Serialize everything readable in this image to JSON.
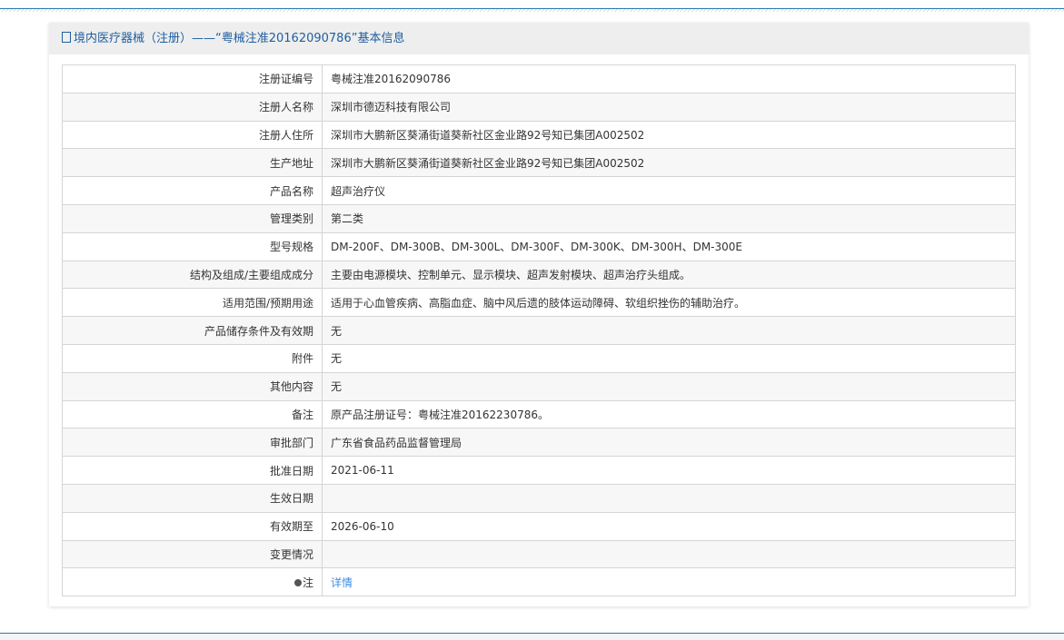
{
  "title": "境内医疗器械（注册）——“粤械注准20162090786”基本信息",
  "rows": [
    {
      "label": "注册证编号",
      "value": "粤械注准20162090786"
    },
    {
      "label": "注册人名称",
      "value": "深圳市德迈科技有限公司"
    },
    {
      "label": "注册人住所",
      "value": "深圳市大鹏新区葵涌街道葵新社区金业路92号知已集团A002502"
    },
    {
      "label": "生产地址",
      "value": "深圳市大鹏新区葵涌街道葵新社区金业路92号知已集团A002502"
    },
    {
      "label": "产品名称",
      "value": "超声治疗仪"
    },
    {
      "label": "管理类别",
      "value": "第二类"
    },
    {
      "label": "型号规格",
      "value": "DM-200F、DM-300B、DM-300L、DM-300F、DM-300K、DM-300H、DM-300E"
    },
    {
      "label": "结构及组成/主要组成成分",
      "value": "主要由电源模块、控制单元、显示模块、超声发射模块、超声治疗头组成。"
    },
    {
      "label": "适用范围/预期用途",
      "value": "适用于心血管疾病、高脂血症、脑中风后遗的肢体运动障碍、软组织挫伤的辅助治疗。"
    },
    {
      "label": "产品储存条件及有效期",
      "value": "无"
    },
    {
      "label": "附件",
      "value": "无"
    },
    {
      "label": "其他内容",
      "value": "无"
    },
    {
      "label": "备注",
      "value": "原产品注册证号：粤械注准20162230786。"
    },
    {
      "label": "审批部门",
      "value": "广东省食品药品监督管理局"
    },
    {
      "label": "批准日期",
      "value": "2021-06-11"
    },
    {
      "label": "生效日期",
      "value": ""
    },
    {
      "label": "有效期至",
      "value": "2026-06-10"
    },
    {
      "label": "变更情况",
      "value": ""
    }
  ],
  "note": {
    "label": "注",
    "link": "详情"
  }
}
